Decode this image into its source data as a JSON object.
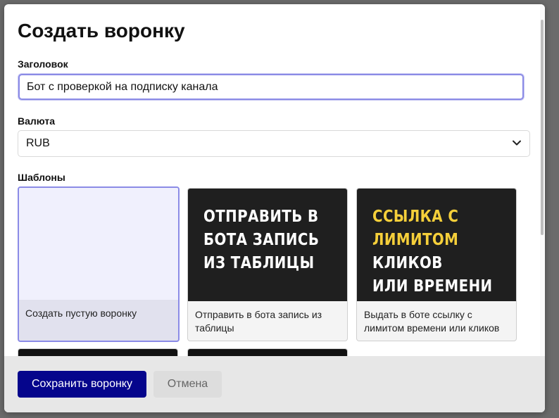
{
  "modal": {
    "title": "Создать воронку",
    "fields": {
      "title_label": "Заголовок",
      "title_value": "Бот с проверкой на подписку канала",
      "currency_label": "Валюта",
      "currency_value": "RUB"
    },
    "templates": {
      "label": "Шаблоны",
      "items": [
        {
          "caption": "Создать пустую воронку",
          "selected": true,
          "thumb_lines": []
        },
        {
          "caption": "Отправить в бота запись из таблицы",
          "thumb_lines": [
            "ОТПРАВИТЬ В",
            "БОТА ЗАПИСЬ",
            "ИЗ ТАБЛИЦЫ"
          ]
        },
        {
          "caption": "Выдать в боте ссылку с лимитом времени или кликов",
          "thumb_lines": [
            "ССЫЛКА С",
            "ЛИМИТОМ",
            "КЛИКОВ",
            "ИЛИ ВРЕМЕНИ"
          ]
        }
      ]
    },
    "footer": {
      "save_label": "Сохранить воронку",
      "cancel_label": "Отмена"
    },
    "colors": {
      "primary_button": "#05058c",
      "selected_border": "#8b8be6",
      "thumb_accent": "#f5cf3a",
      "thumb_background": "#1f1f1f"
    },
    "icons": [
      "chevron-down-icon"
    ]
  }
}
